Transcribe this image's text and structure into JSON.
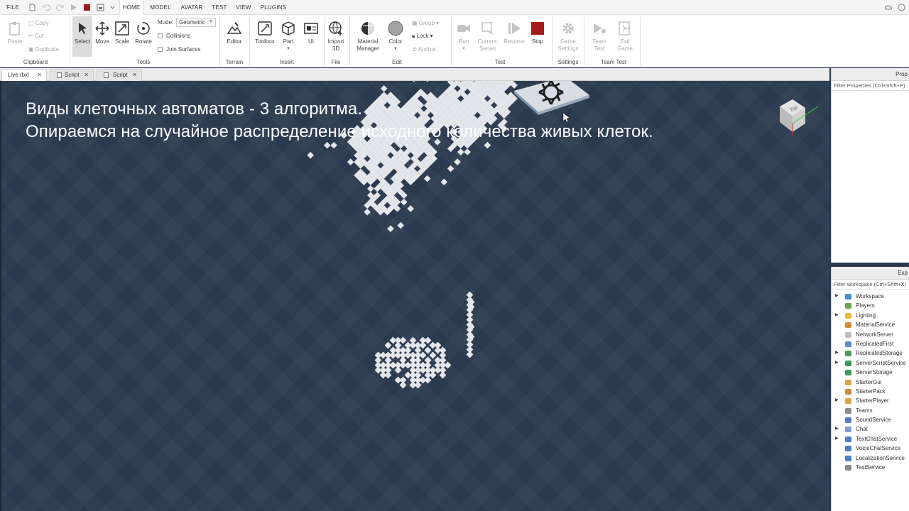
{
  "menubar": {
    "file": "FILE",
    "tabs": [
      "HOME",
      "MODEL",
      "AVATAR",
      "TEST",
      "VIEW",
      "PLUGINS"
    ]
  },
  "ribbon": {
    "clipboard": {
      "paste": "Paste",
      "copy": "Copy",
      "cut": "Cut",
      "duplicate": "Duplicate",
      "label": "Clipboard"
    },
    "tools": {
      "select": "Select",
      "move": "Move",
      "scale": "Scale",
      "rotate": "Rotate",
      "mode_label": "Mode:",
      "mode_value": "Geometric",
      "collisions": "Collisions",
      "join_surfaces": "Join Surfaces",
      "label": "Tools"
    },
    "terrain": {
      "editor": "Editor",
      "label": "Terrain"
    },
    "insert": {
      "toolbox": "Toolbox",
      "part": "Part",
      "ui": "UI",
      "label": "Insert"
    },
    "file": {
      "import3d_1": "Import",
      "import3d_2": "3D",
      "label": "File"
    },
    "edit": {
      "material_1": "Material",
      "material_2": "Manager",
      "color": "Color",
      "group": "Group",
      "lock": "Lock",
      "anchor": "Anchor",
      "label": "Edit"
    },
    "test": {
      "run": "Run",
      "current_1": "Current:",
      "current_2": "Server",
      "resume": "Resume",
      "stop": "Stop",
      "label": "Test"
    },
    "settings": {
      "game_1": "Game",
      "game_2": "Settings",
      "label": "Settings"
    },
    "team_test": {
      "team_1": "Team",
      "team_2": "Test",
      "exit_1": "Exit",
      "exit_2": "Game",
      "label": "Team Test"
    }
  },
  "doc_tabs": [
    "Live.rbxl",
    "Script",
    "Script"
  ],
  "viewport": {
    "line1": "Виды клеточных автоматов - 3 алгоритма.",
    "line2": "Опираемся на случайное распределение исходного количества живых клеток.",
    "view_cube": "Top"
  },
  "properties": {
    "title": "Prop",
    "filter_placeholder": "Filter Properties (Ctrl+Shift+P)"
  },
  "explorer": {
    "title": "Exp",
    "filter_placeholder": "Filter workspace (Ctrl+Shift+X)",
    "items": [
      {
        "label": "Workspace",
        "expandable": true,
        "color": "#3a8fd6"
      },
      {
        "label": "Players",
        "expandable": false,
        "color": "#6aa84f"
      },
      {
        "label": "Lighting",
        "expandable": true,
        "color": "#e8b73a"
      },
      {
        "label": "MaterialService",
        "expandable": false,
        "color": "#d88a3a"
      },
      {
        "label": "NetworkServer",
        "expandable": false,
        "color": "#bdbdbd"
      },
      {
        "label": "ReplicatedFirst",
        "expandable": false,
        "color": "#5b8bd0"
      },
      {
        "label": "ReplicatedStorage",
        "expandable": true,
        "color": "#4aa05a"
      },
      {
        "label": "ServerScriptService",
        "expandable": true,
        "color": "#3c9c52"
      },
      {
        "label": "ServerStorage",
        "expandable": false,
        "color": "#3c9c52"
      },
      {
        "label": "StarterGui",
        "expandable": false,
        "color": "#d9a441"
      },
      {
        "label": "StarterPack",
        "expandable": false,
        "color": "#c98b3a"
      },
      {
        "label": "StarterPlayer",
        "expandable": true,
        "color": "#d9a441"
      },
      {
        "label": "Teams",
        "expandable": false,
        "color": "#8a8a8a"
      },
      {
        "label": "SoundService",
        "expandable": false,
        "color": "#5a7fc0"
      },
      {
        "label": "Chat",
        "expandable": true,
        "color": "#7f9fd0"
      },
      {
        "label": "TextChatService",
        "expandable": true,
        "color": "#4c7fc9"
      },
      {
        "label": "VoiceChatService",
        "expandable": false,
        "color": "#4c7fc9"
      },
      {
        "label": "LocalizationService",
        "expandable": false,
        "color": "#4c7fc9"
      },
      {
        "label": "TestService",
        "expandable": false,
        "color": "#888888"
      }
    ]
  }
}
